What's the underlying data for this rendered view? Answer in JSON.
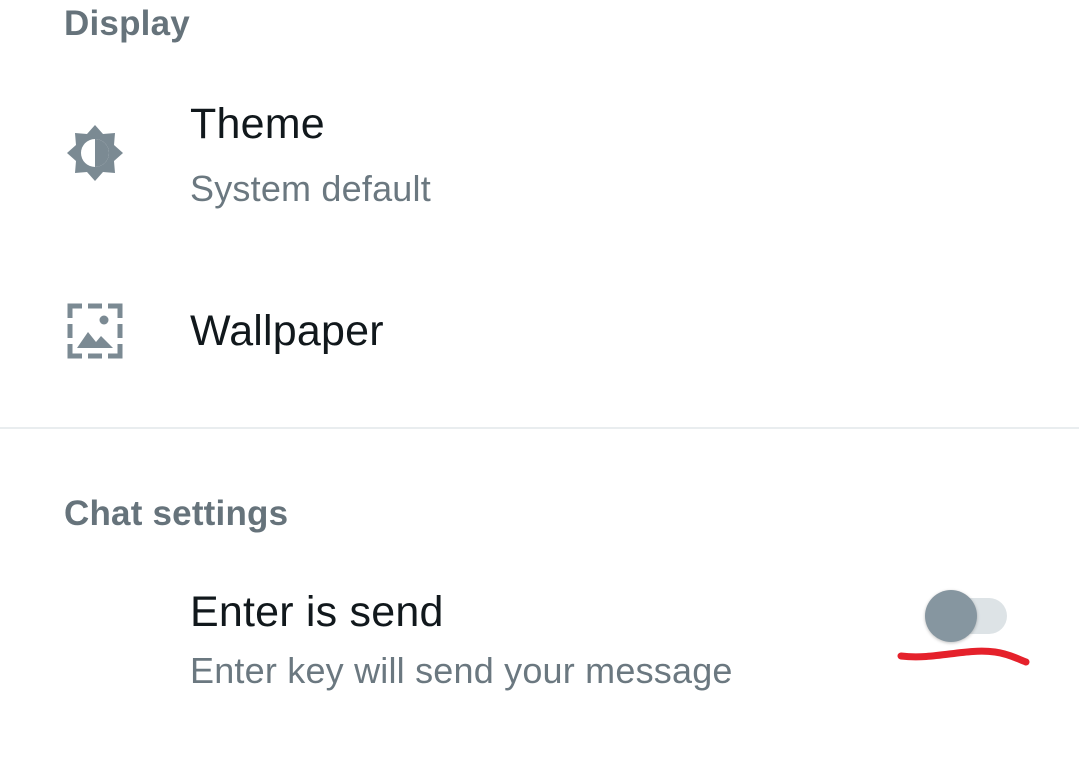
{
  "display": {
    "header": "Display",
    "theme": {
      "title": "Theme",
      "subtitle": "System default",
      "icon": "brightness-icon"
    },
    "wallpaper": {
      "title": "Wallpaper",
      "icon": "wallpaper-icon"
    }
  },
  "chat_settings": {
    "header": "Chat settings",
    "enter_is_send": {
      "title": "Enter is send",
      "subtitle": "Enter key will send your message",
      "enabled": false
    }
  },
  "colors": {
    "header_text": "#66737b",
    "title_text": "#11181c",
    "subtitle_text": "#6b7880",
    "icon": "#7b8a93",
    "toggle_knob_off": "#8696a0",
    "toggle_track_off": "#dde3e6",
    "annotation": "#e5212b"
  }
}
